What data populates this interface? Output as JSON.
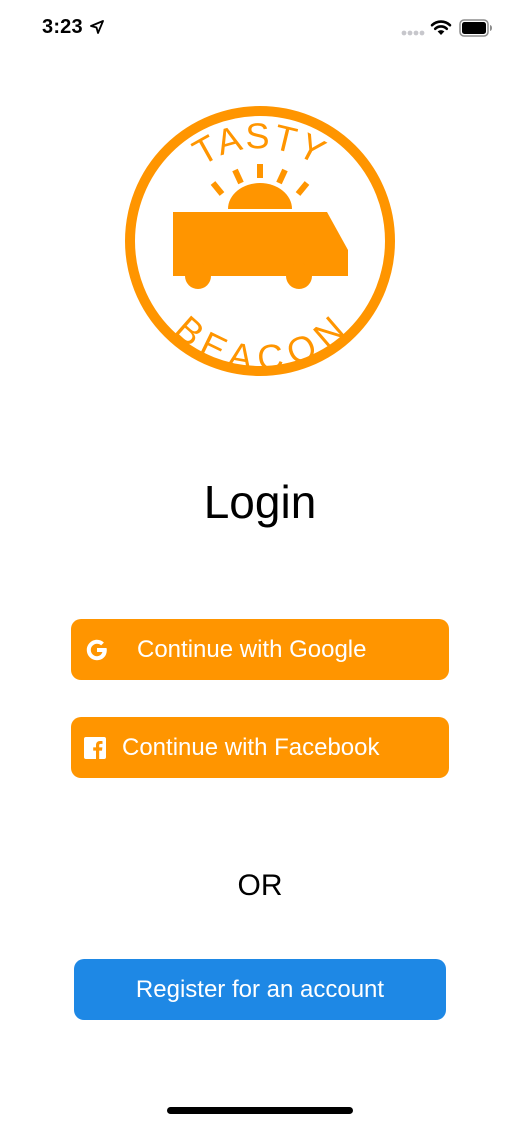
{
  "status_bar": {
    "time": "3:23"
  },
  "logo": {
    "top_text": "TASTY",
    "bottom_text": "BEACON",
    "color": "#FF9500"
  },
  "page": {
    "title": "Login"
  },
  "buttons": {
    "google_label": "Continue with Google",
    "facebook_label": "Continue with Facebook",
    "register_label": "Register for an account"
  },
  "divider_text": "OR",
  "colors": {
    "accent_orange": "#FF9500",
    "register_blue": "#1E88E5",
    "background": "#FFFFFF"
  }
}
